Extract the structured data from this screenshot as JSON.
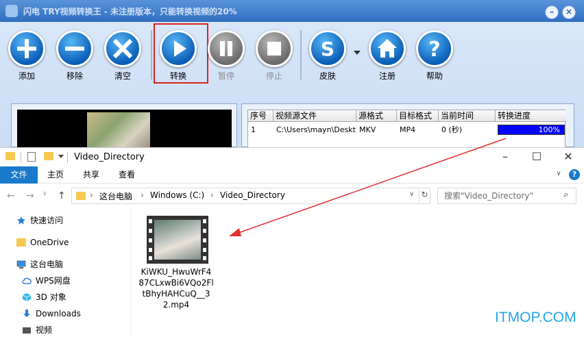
{
  "converter": {
    "title": "闪电 TRY视频转换王 - 未注册版本，只能转换视频的20%",
    "toolbar": [
      {
        "id": "add",
        "label": "添加",
        "icon": "plus-icon",
        "state": "enabled"
      },
      {
        "id": "remove",
        "label": "移除",
        "icon": "minus-icon",
        "state": "enabled"
      },
      {
        "id": "clear",
        "label": "清空",
        "icon": "x-icon",
        "state": "enabled"
      },
      {
        "id": "convert",
        "label": "转换",
        "icon": "play-icon",
        "state": "enabled",
        "highlighted": true
      },
      {
        "id": "pause",
        "label": "暂停",
        "icon": "pause-icon",
        "state": "disabled"
      },
      {
        "id": "stop",
        "label": "停止",
        "icon": "stop-icon",
        "state": "disabled"
      },
      {
        "id": "skin",
        "label": "皮肤",
        "icon": "skin-s-icon",
        "state": "enabled"
      },
      {
        "id": "register",
        "label": "注册",
        "icon": "home-icon",
        "state": "enabled"
      },
      {
        "id": "help",
        "label": "帮助",
        "icon": "question-icon",
        "state": "enabled"
      }
    ],
    "table": {
      "headers": [
        "序号",
        "视频源文件",
        "源格式",
        "目标格式",
        "当前时间",
        "转换进度"
      ],
      "rows": [
        {
          "index": "1",
          "source": "C:\\Users\\mayn\\Deskt...",
          "src_format": "MKV",
          "dst_format": "MP4",
          "time": "0  (秒)",
          "progress": 1.0,
          "progress_text": "100%"
        }
      ]
    },
    "colors": {
      "titlebar": "#2f6ec0",
      "progress": "#0000ff",
      "highlight": "#e02020"
    }
  },
  "explorer": {
    "title": "Video_Directory",
    "ribbon_tabs": [
      "文件",
      "主页",
      "共享",
      "查看"
    ],
    "breadcrumb": [
      "这台电脑",
      "Windows (C:)",
      "Video_Directory"
    ],
    "search_placeholder": "搜索\"Video_Directory\"",
    "nav_items": [
      {
        "label": "快速访问",
        "icon": "star-icon"
      },
      {
        "label": "OneDrive",
        "icon": "folder-icon"
      },
      {
        "label": "这台电脑",
        "icon": "computer-icon"
      },
      {
        "label": "WPS网盘",
        "icon": "cloud-icon"
      },
      {
        "label": "3D 对象",
        "icon": "cube-icon"
      },
      {
        "label": "Downloads",
        "icon": "download-icon"
      },
      {
        "label": "视频",
        "icon": "video-icon"
      }
    ],
    "file": {
      "name": "KiWKU_HwuWrF487CLxwBi6VQo2FltBhyHAHCuQ__32.mp4",
      "icon": "video-file-icon"
    },
    "colors": {
      "file_tab": "#1979ca",
      "folder": "#f6c950"
    }
  },
  "watermark": "ITMOP.COM"
}
